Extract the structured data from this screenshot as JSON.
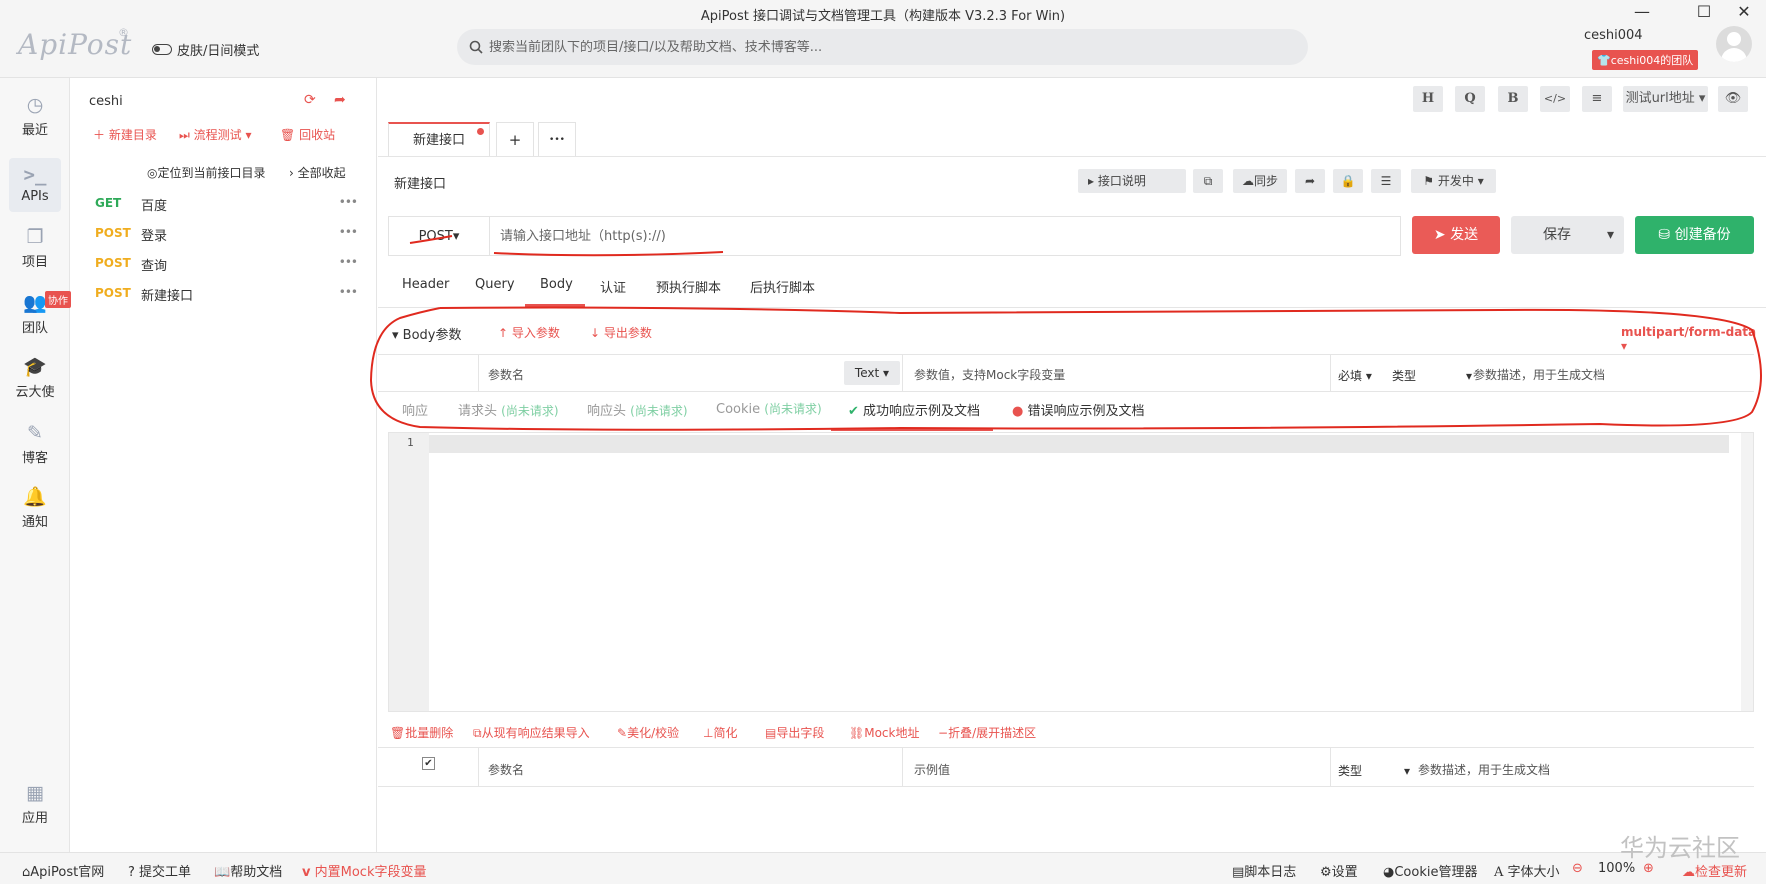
{
  "window": {
    "title": "ApiPost 接口调试与文档管理工具（构建版本 V3.2.3 For Win)",
    "logo": "ApiPost",
    "logo_reg": "®",
    "skin_mode": "皮肤/日间模式",
    "search_placeholder": "搜索当前团队下的项目/接口/以及帮助文档、技术博客等...",
    "username": "ceshi004",
    "team": "ceshi004的团队"
  },
  "leftnav": {
    "items": [
      {
        "label": "最近",
        "icon": "clock-icon"
      },
      {
        "label": "APIs",
        "icon": "terminal-icon"
      },
      {
        "label": "项目",
        "icon": "project-icon"
      },
      {
        "label": "团队",
        "icon": "team-icon"
      },
      {
        "label": "云大使",
        "icon": "graduation-cap-icon"
      },
      {
        "label": "博客",
        "icon": "edit-icon"
      },
      {
        "label": "通知",
        "icon": "bell-icon"
      },
      {
        "label": "应用",
        "icon": "grid-icon"
      }
    ],
    "collab_badge": "协作"
  },
  "tree": {
    "project": "ceshi",
    "new_dir": "新建目录",
    "flow_test": "流程测试",
    "recycle": "回收站",
    "locate": "定位到当前接口目录",
    "collapse_all": "全部收起",
    "items": [
      {
        "method": "GET",
        "name": "百度"
      },
      {
        "method": "POST",
        "name": "登录"
      },
      {
        "method": "POST",
        "name": "查询"
      },
      {
        "method": "POST",
        "name": "新建接口"
      }
    ]
  },
  "toolbar": {
    "buttons": [
      "H",
      "Q",
      "B",
      "</>",
      "≡"
    ],
    "env": "测试url地址"
  },
  "tabs": {
    "active": "新建接口",
    "add": "+",
    "more": "•••"
  },
  "request": {
    "name": "新建接口",
    "doc_btn": "接口说明",
    "sync_btn": "同步",
    "status": "开发中",
    "method": "POST",
    "url_placeholder": "请输入接口地址（http(s)://)",
    "send": "发送",
    "save": "保存",
    "backup": "创建备份",
    "tabs": [
      "Header",
      "Query",
      "Body",
      "认证",
      "预执行脚本",
      "后执行脚本"
    ],
    "active_tab": "Body"
  },
  "body": {
    "section": "Body参数",
    "import": "导入参数",
    "export": "导出参数",
    "content_type": "multipart/form-data",
    "param_name": "参数名",
    "type_text": "Text",
    "value_placeholder": "参数值，支持Mock字段变量",
    "required": "必填",
    "type": "类型",
    "desc": "参数描述，用于生成文档"
  },
  "response": {
    "tabs": [
      {
        "label": "响应",
        "muted": ""
      },
      {
        "label": "请求头",
        "muted": "(尚未请求)"
      },
      {
        "label": "响应头",
        "muted": "(尚未请求)"
      },
      {
        "label": "Cookie",
        "muted": "(尚未请求)"
      }
    ],
    "success_doc": "成功响应示例及文档",
    "error_doc": "错误响应示例及文档",
    "line_number": "1"
  },
  "actions": [
    "批量删除",
    "从现有响应结果导入",
    "美化/校验",
    "简化",
    "导出字段",
    "Mock地址",
    "折叠/展开描述区"
  ],
  "doc_table": {
    "param_name": "参数名",
    "example": "示例值",
    "type": "类型",
    "desc": "参数描述，用于生成文档"
  },
  "footer": {
    "official": "ApiPost官网",
    "ticket": "提交工单",
    "help": "帮助文档",
    "mock": "内置Mock字段变量",
    "script_log": "脚本日志",
    "settings": "设置",
    "cookie": "Cookie管理器",
    "font": "字体大小",
    "zoom": "100%",
    "update": "检查更新"
  },
  "watermark": "华为云社区",
  "colors": {
    "accent_red": "#e8534f",
    "get_green": "#2faa59",
    "post_orange": "#f0ad1f",
    "backup_green": "#2fb26b"
  }
}
